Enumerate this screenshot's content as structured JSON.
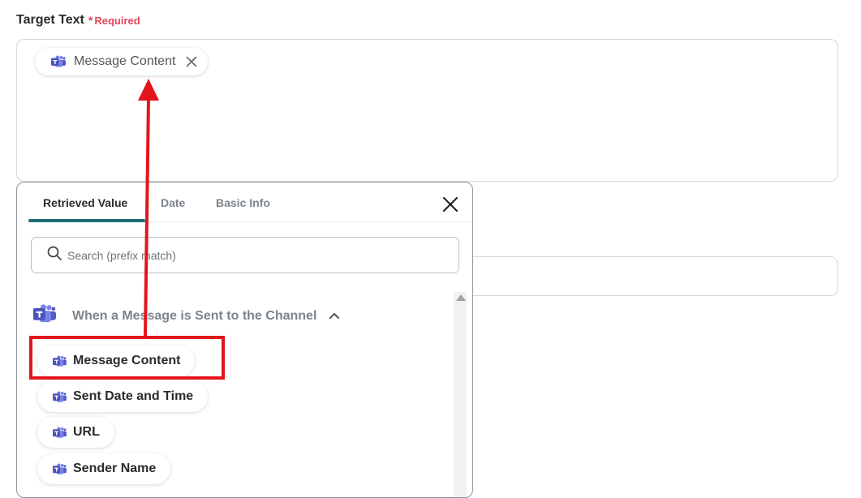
{
  "field": {
    "label": "Target Text",
    "required_mark": "*",
    "required_text": "Required"
  },
  "selected_chip": {
    "label": "Message Content",
    "icon": "microsoft-teams-icon"
  },
  "panel": {
    "tabs": [
      {
        "label": "Retrieved Value",
        "active": true
      },
      {
        "label": "Date",
        "active": false
      },
      {
        "label": "Basic Info",
        "active": false
      }
    ],
    "search_placeholder": "Search (prefix match)",
    "group": {
      "title": "When a Message is Sent to the Channel",
      "expanded": true,
      "icon": "microsoft-teams-icon"
    },
    "options": [
      {
        "label": "Message Content"
      },
      {
        "label": "Sent Date and Time"
      },
      {
        "label": "URL"
      },
      {
        "label": "Sender Name"
      }
    ]
  },
  "annotation": {
    "highlight_color": "#e3151b",
    "arrow_color": "#e3151b",
    "highlighted_option": "Message Content"
  },
  "colors": {
    "teams_purple": "#5b5fc7",
    "tab_accent": "#1e6d78",
    "required_red": "#e6465a"
  }
}
